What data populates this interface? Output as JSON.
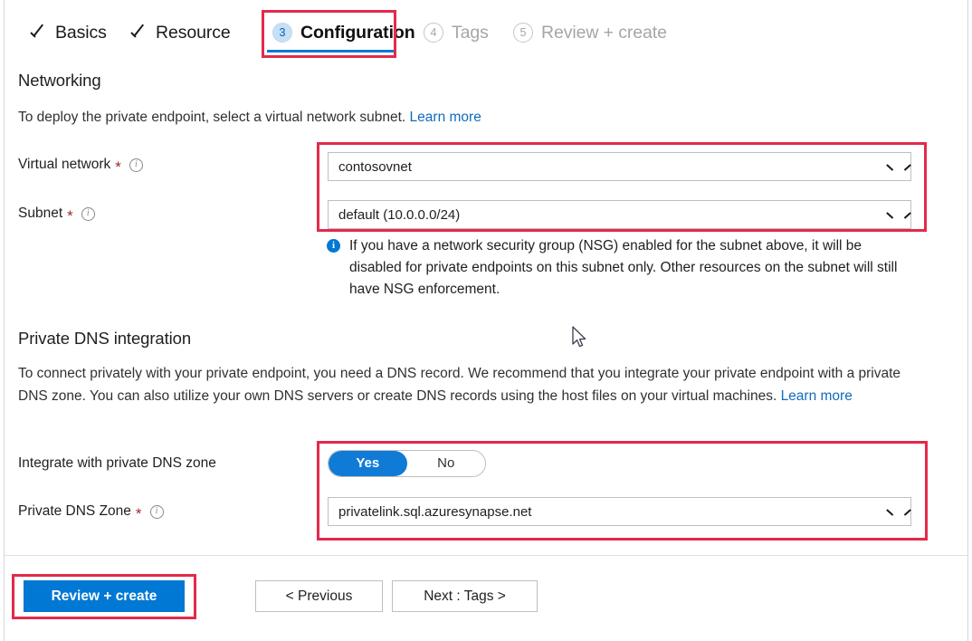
{
  "wizard": {
    "tabs": [
      {
        "label": "Basics",
        "state": "done",
        "marker": "check"
      },
      {
        "label": "Resource",
        "state": "done",
        "marker": "check"
      },
      {
        "label": "Configuration",
        "state": "active",
        "marker": "3"
      },
      {
        "label": "Tags",
        "state": "todo",
        "marker": "4"
      },
      {
        "label": "Review + create",
        "state": "todo",
        "marker": "5"
      }
    ]
  },
  "networking": {
    "heading": "Networking",
    "description": "To deploy the private endpoint, select a virtual network subnet.",
    "learn_more": "Learn more",
    "virtual_network": {
      "label": "Virtual network",
      "required_marker": "*",
      "info_icon": "i",
      "value": "contosovnet"
    },
    "subnet": {
      "label": "Subnet",
      "required_marker": "*",
      "info_icon": "i",
      "value": "default (10.0.0.0/24)"
    },
    "nsg_note": "If you have a network security group (NSG) enabled for the subnet above, it will be disabled for private endpoints on this subnet only. Other resources on the subnet will still have NSG enforcement."
  },
  "private_dns": {
    "heading": "Private DNS integration",
    "description": "To connect privately with your private endpoint, you need a DNS record. We recommend that you integrate your private endpoint with a private DNS zone. You can also utilize your own DNS servers or create DNS records using the host files on your virtual machines.",
    "learn_more": "Learn more",
    "integrate_toggle": {
      "label": "Integrate with private DNS zone",
      "selected": "Yes",
      "options": [
        "Yes",
        "No"
      ]
    },
    "zone": {
      "label": "Private DNS Zone",
      "required_marker": "*",
      "info_icon": "i",
      "value": "privatelink.sql.azuresynapse.net"
    }
  },
  "footer": {
    "review_create": "Review + create",
    "previous": "< Previous",
    "next": "Next : Tags >"
  },
  "colors": {
    "accent": "#0078d4",
    "highlight_box": "#e4294b",
    "required": "#a4262c",
    "link": "#0f6cbd",
    "active_badge_bg": "#c7e0f4",
    "disabled_text": "#a6a6a6"
  }
}
